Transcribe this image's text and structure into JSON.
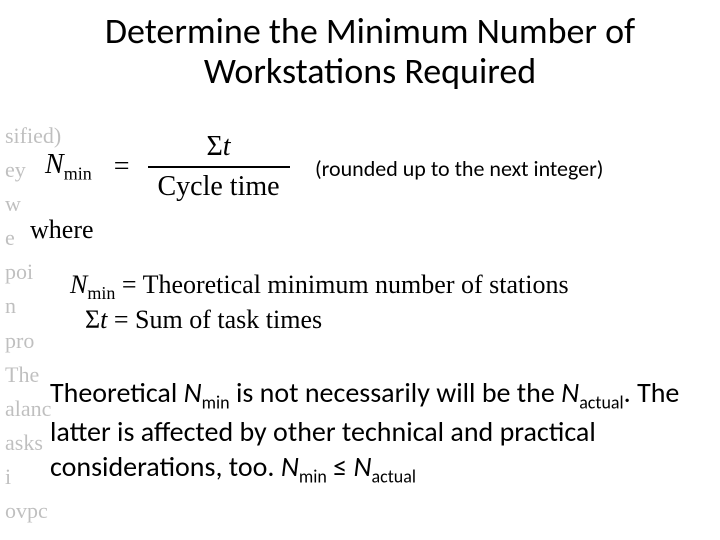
{
  "title": "Determine the Minimum Number of Workstations Required",
  "formula": {
    "lhs_sym": "N",
    "lhs_sub": "min",
    "eq": "=",
    "num_sigma": "Σ",
    "num_var": "t",
    "den": "Cycle time"
  },
  "note": "(rounded up to the next integer)",
  "where": "where",
  "defs": {
    "d1_lhs_sym": "N",
    "d1_lhs_sub": "min",
    "d1_eq": " = ",
    "d1_rhs": "Theoretical minimum number of stations",
    "d2_lhs_sigma": "Σ",
    "d2_lhs_var": "t",
    "d2_eq": " = ",
    "d2_rhs": "Sum of task times"
  },
  "body": {
    "p1a": "Theoretical ",
    "p1_N": "N",
    "p1_min": "min",
    "p1b": " is not necessarily will be the ",
    "p2_N": "N",
    "p2_act": "actual",
    "p2a": ". The latter is affected by other technical and practical considerations, too.    ",
    "ineq_N1": "N",
    "ineq_min": "min",
    "ineq_op": " ≤ ",
    "ineq_N2": "N",
    "ineq_act": "actual"
  },
  "ghost": {
    "g1": "sified)",
    "g2": "ey w",
    "g3": "e poi",
    "g4": "n pro",
    "g5": "      The",
    "g6": "alanc",
    "g7": "asks i",
    "g8": "ovpc"
  }
}
